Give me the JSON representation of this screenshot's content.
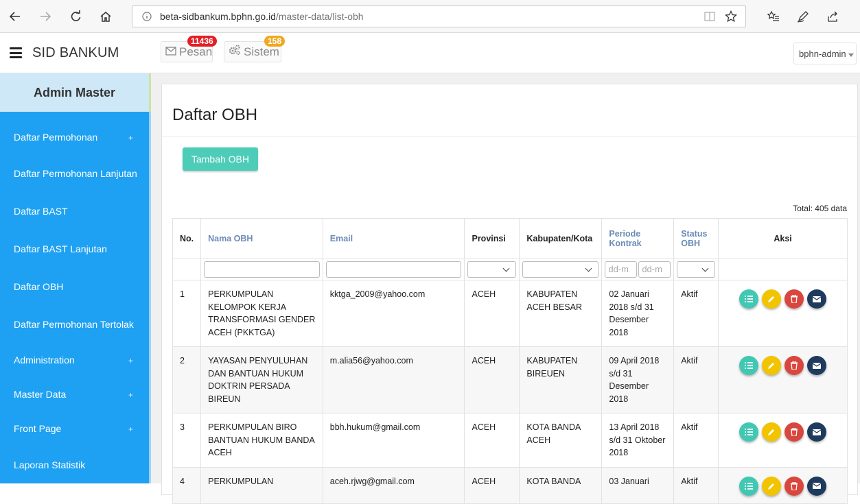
{
  "browser": {
    "url_host": "beta-sidbankum.bphn.go.id",
    "url_path": "/master-data/list-obh"
  },
  "header": {
    "brand": "SID BANKUM",
    "pesan_label": "Pesan",
    "pesan_count": "11436",
    "sistem_label": "Sistem",
    "sistem_count": "158",
    "user": "bphn-admin"
  },
  "sidebar": {
    "title": "Admin Master",
    "items": [
      {
        "label": "Daftar Permohonan",
        "expandable": true
      },
      {
        "label": "Daftar Permohonan Lanjutan",
        "expandable": false
      },
      {
        "label": "Daftar BAST",
        "expandable": false
      },
      {
        "label": "Daftar BAST Lanjutan",
        "expandable": false
      },
      {
        "label": "Daftar OBH",
        "expandable": false
      },
      {
        "label": "Daftar Permohonan Tertolak",
        "expandable": false
      },
      {
        "label": "Administration",
        "expandable": true
      },
      {
        "label": "Master Data",
        "expandable": true
      },
      {
        "label": "Front Page",
        "expandable": true
      },
      {
        "label": "Laporan Statistik",
        "expandable": false
      }
    ]
  },
  "main": {
    "title": "Daftar OBH",
    "add_button": "Tambah OBH",
    "total": "Total: 405 data",
    "date_placeholder": "dd-m",
    "columns": {
      "no": "No.",
      "nama": "Nama OBH",
      "email": "Email",
      "provinsi": "Provinsi",
      "kabupaten": "Kabupaten/Kota",
      "periode": "Periode Kontrak",
      "status": "Status OBH",
      "aksi": "Aksi"
    },
    "rows": [
      {
        "no": "1",
        "nama": "PERKUMPULAN KELOMPOK KERJA TRANSFORMASI GENDER ACEH (PKKTGA)",
        "email": "kktga_2009@yahoo.com",
        "provinsi": "ACEH",
        "kabupaten": "KABUPATEN ACEH BESAR",
        "periode": "02 Januari 2018 s/d 31 Desember 2018",
        "status": "Aktif"
      },
      {
        "no": "2",
        "nama": "YAYASAN PENYULUHAN DAN BANTUAN HUKUM DOKTRIN PERSADA BIREUN",
        "email": "m.alia56@yahoo.com",
        "provinsi": "ACEH",
        "kabupaten": "KABUPATEN BIREUEN",
        "periode": "09 April 2018 s/d 31 Desember 2018",
        "status": "Aktif"
      },
      {
        "no": "3",
        "nama": "PERKUMPULAN BIRO BANTUAN HUKUM BANDA ACEH",
        "email": "bbh.hukum@gmail.com",
        "provinsi": "ACEH",
        "kabupaten": "KOTA BANDA ACEH",
        "periode": "13 April 2018 s/d 31 Oktober 2018",
        "status": "Aktif"
      },
      {
        "no": "4",
        "nama": "PERKUMPULAN",
        "email": "aceh.rjwg@gmail.com",
        "provinsi": "ACEH",
        "kabupaten": "KOTA BANDA",
        "periode": "03 Januari",
        "status": "Aktif"
      }
    ]
  },
  "colors": {
    "sidebar": "#1ea1f2",
    "add_button": "#4dcdb8",
    "action_detail": "#40c8b3",
    "action_edit": "#f2c400",
    "action_delete": "#d9463e",
    "action_email": "#1e3a5c"
  }
}
